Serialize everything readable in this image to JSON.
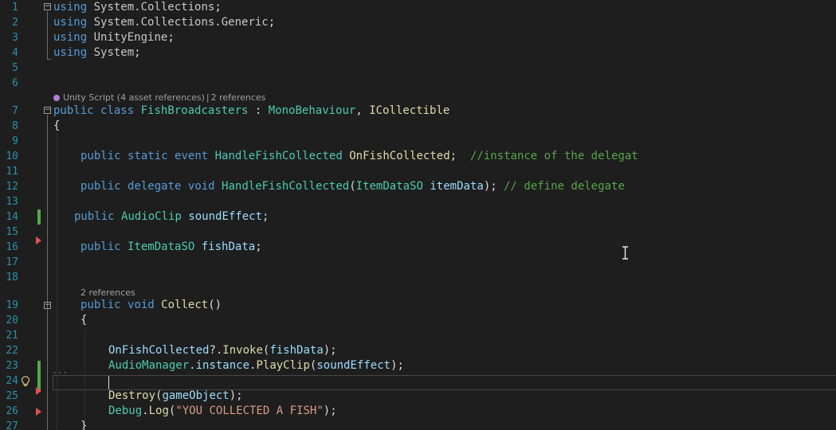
{
  "line_numbers": [
    "1",
    "2",
    "3",
    "4",
    "5",
    "6",
    "7",
    "8",
    "9",
    "10",
    "11",
    "12",
    "13",
    "14",
    "15",
    "16",
    "17",
    "18",
    "19",
    "20",
    "21",
    "22",
    "23",
    "24",
    "25",
    "26",
    "27"
  ],
  "code": {
    "l1": {
      "kw": "using",
      "ns": "System.Collections",
      "punct": ";"
    },
    "l2": {
      "kw": "using",
      "ns": "System.Collections.Generic",
      "punct": ";"
    },
    "l3": {
      "kw": "using",
      "ns": "UnityEngine",
      "punct": ";"
    },
    "l4": {
      "kw": "using",
      "ns": "System",
      "punct": ";"
    },
    "l7": {
      "kw1": "public",
      "kw2": "class",
      "name": "FishBroadcasters",
      "colon": " : ",
      "base1": "MonoBehaviour",
      "comma": ", ",
      "base2": "ICollectible"
    },
    "l8": {
      "text": "{"
    },
    "l10": {
      "kw1": "public",
      "kw2": "static",
      "kw3": "event",
      "type": "HandleFishCollected",
      "name": "OnFishCollected",
      "punct": ";",
      "comment": "//instance of the delegat"
    },
    "l12": {
      "kw1": "public",
      "kw2": "delegate",
      "kw3": "void",
      "name": "HandleFishCollected",
      "open": "(",
      "ptype": "ItemDataSO",
      "pname": "itemData",
      "close": ");",
      "comment": "// define delegate"
    },
    "l14": {
      "kw": "public",
      "type": "AudioClip",
      "name": "soundEffect",
      "punct": ";"
    },
    "l16": {
      "kw": "public",
      "type": "ItemDataSO",
      "name": "fishData",
      "punct": ";"
    },
    "l19": {
      "kw1": "public",
      "kw2": "void",
      "name": "Collect",
      "punct": "()"
    },
    "l20": {
      "text": "{"
    },
    "l22": {
      "event": "OnFishCollected",
      "op": "?.",
      "method": "Invoke",
      "open": "(",
      "arg": "fishData",
      "close": ");"
    },
    "l23": {
      "cls": "AudioManager",
      "dot1": ".",
      "member": "instance",
      "dot2": ".",
      "method": "PlayClip",
      "open": "(",
      "arg": "soundEffect",
      "close": ");"
    },
    "l25": {
      "method": "Destroy",
      "open": "(",
      "arg": "gameObject",
      "close": ");"
    },
    "l26": {
      "cls": "Debug",
      "dot": ".",
      "method": "Log",
      "open": "(",
      "str": "\"YOU COLLECTED A FISH\"",
      "close": ");"
    },
    "l27": {
      "text": "}"
    }
  },
  "codelens": {
    "class_refs": {
      "unity": "Unity Script (4 asset references)",
      "sep": "|",
      "refs": "2 references"
    },
    "collect_refs": {
      "refs": "2 references"
    }
  },
  "colors": {
    "background": "#1e1e1e",
    "keyword": "#569cd6",
    "type": "#4ec9b0",
    "method": "#dcdcaa",
    "variable": "#9cdcfe",
    "comment": "#57a64a",
    "string": "#d69d85",
    "line_number": "#2b91af",
    "change_bar": "#57a64a",
    "breakpoint_arrow": "#e05252"
  },
  "icons": {
    "fold": "fold-toggle-icon",
    "lightbulb": "lightbulb-icon",
    "unity": "unity-icon",
    "cursor": "ibeam-cursor-icon",
    "arrow": "breakpoint-arrow-icon"
  }
}
